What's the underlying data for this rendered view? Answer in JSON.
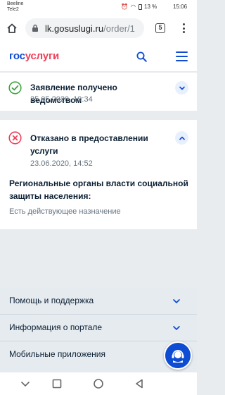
{
  "status_bar": {
    "carrier_1": "Beeline",
    "carrier_2": "Tele2",
    "battery_text": "13 %",
    "time": "15:06"
  },
  "browser": {
    "url_host": "lk.gosuslugi.ru",
    "url_path": "/order/1",
    "tab_count": "5"
  },
  "header": {
    "logo_part_1": "гос",
    "logo_part_2": "услуги",
    "brand_blue": "#0d4cd3",
    "brand_red": "#ee3f58"
  },
  "statuses": [
    {
      "title": "Заявление получено ведомством",
      "date": "25.05.2020, 19:34",
      "icon": "check-circle-icon",
      "color": "#3fa33f",
      "expanded": false
    },
    {
      "title": "Отказано в предоставлении услуги",
      "date": "23.06.2020, 14:52",
      "icon": "x-circle-icon",
      "color": "#ee3f58",
      "expanded": true,
      "organization": "Региональные органы власти социальной защиты населения:",
      "note": "Есть действующее назначение"
    }
  ],
  "footer": {
    "items": [
      {
        "label": "Помощь и поддержка"
      },
      {
        "label": "Информация о портале"
      },
      {
        "label": "Мобильные приложения"
      }
    ]
  }
}
